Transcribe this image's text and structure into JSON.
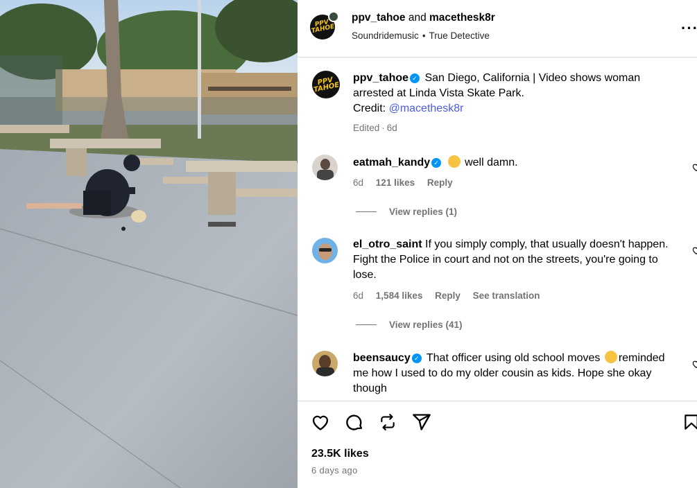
{
  "post": {
    "author": "ppv_tahoe",
    "conjunction": "and",
    "collaborator": "macethesk8r",
    "subtitle_music": "Soundridemusic",
    "subtitle_song": "True Detective",
    "avatar_text": "PPV TAHOE",
    "more_icon": "more-horizontal-icon"
  },
  "caption": {
    "user": "ppv_tahoe",
    "text": "San Diego, California | Video shows woman arrested at Linda Vista Skate Park.",
    "credit_label": "Credit:",
    "credit_link": "@macethesk8r",
    "edited": "Edited",
    "time": "6d"
  },
  "comments": [
    {
      "user": "eatmah_kandy",
      "verified": true,
      "text": "well damn.",
      "time": "6d",
      "likes": "121 likes",
      "reply": "Reply",
      "view_replies": "View replies (1)"
    },
    {
      "user": "el_otro_saint",
      "verified": false,
      "text": "If you simply comply, that usually doesn't happen. Fight the Police in court and not on the streets, you're going to lose.",
      "time": "6d",
      "likes": "1,584 likes",
      "reply": "Reply",
      "translate": "See translation",
      "view_replies": "View replies (41)"
    },
    {
      "user": "beensaucy",
      "verified": true,
      "text_before": "That officer using old school moves",
      "text_after": "reminded me how I used to do my older cousin as kids. Hope she okay though"
    }
  ],
  "actions": {
    "like_icon": "heart-icon",
    "comment_icon": "comment-icon",
    "repost_icon": "repost-icon",
    "share_icon": "share-icon",
    "save_icon": "bookmark-icon"
  },
  "stats": {
    "likes": "23.5K likes",
    "date": "6 days ago"
  },
  "colors": {
    "link": "#4a5ce0",
    "verified": "#0095f6",
    "meta": "#737373",
    "divider": "#dbdbdb"
  }
}
